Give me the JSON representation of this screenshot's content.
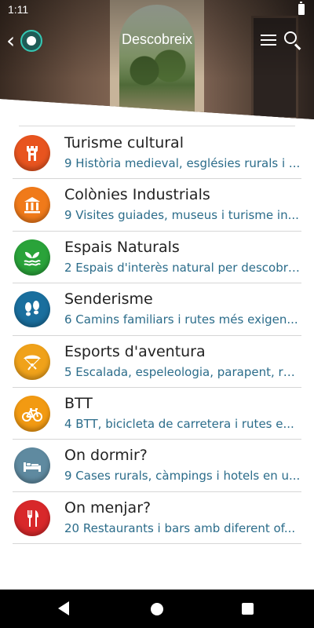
{
  "status_bar": {
    "time": "1:11"
  },
  "app_bar": {
    "title": "Descobreix"
  },
  "categories": [
    {
      "name": "Turisme cultural",
      "description": "9 Història medieval, esglésies rurals i ...",
      "icon": "castle-tower-icon",
      "color": "#e8541f"
    },
    {
      "name": "Colònies Industrials",
      "description": "9 Visites guiades, museus i turisme in...",
      "icon": "museum-columns-icon",
      "color": "#f07a1a"
    },
    {
      "name": "Espais Naturals",
      "description": "2 Espais d'interès natural per descobri...",
      "icon": "leaf-water-icon",
      "color": "#2aa33a"
    },
    {
      "name": "Senderisme",
      "description": "6 Camins familiars i rutes més exigen...",
      "icon": "footprints-icon",
      "color": "#1a6f9e"
    },
    {
      "name": "Esports d'aventura",
      "description": "5 Escalada, espeleologia, parapent, ru...",
      "icon": "paraglider-icon",
      "color": "#f0a21a"
    },
    {
      "name": "BTT",
      "description": "4 BTT, bicicleta de carretera i rutes e...",
      "icon": "bicycle-icon",
      "color": "#f29a12"
    },
    {
      "name": "On dormir?",
      "description": "9 Cases rurals, càmpings i hotels en u...",
      "icon": "bed-icon",
      "color": "#5f8aa0"
    },
    {
      "name": "On menjar?",
      "description": "20 Restaurants i bars amb diferent of...",
      "icon": "fork-knife-icon",
      "color": "#d8282a"
    }
  ]
}
